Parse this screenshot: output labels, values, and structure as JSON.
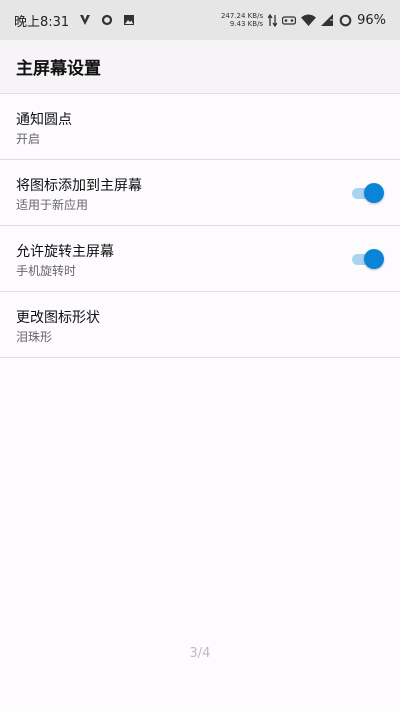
{
  "status_bar": {
    "time": "晚上8:31",
    "upload_speed": "247.24 KB/s",
    "download_speed": "9.43 KB/s",
    "battery": "96%",
    "icons": [
      "notification-v-icon",
      "circle-icon",
      "image-icon",
      "data-arrows-icon",
      "vr-icon",
      "wifi-icon",
      "signal-icon",
      "battery-ring-icon"
    ]
  },
  "app_bar": {
    "title": "主屏幕设置"
  },
  "settings": [
    {
      "title": "通知圆点",
      "subtitle": "开启"
    },
    {
      "title": "将图标添加到主屏幕",
      "subtitle": "适用于新应用",
      "toggle": true
    },
    {
      "title": "允许旋转主屏幕",
      "subtitle": "手机旋转时",
      "toggle": true
    },
    {
      "title": "更改图标形状",
      "subtitle": "泪珠形"
    }
  ],
  "page_indicator": "3/4",
  "colors": {
    "accent": "#0a84d6",
    "accent_track": "#a9d3ef",
    "background": "#fdfbfe"
  }
}
